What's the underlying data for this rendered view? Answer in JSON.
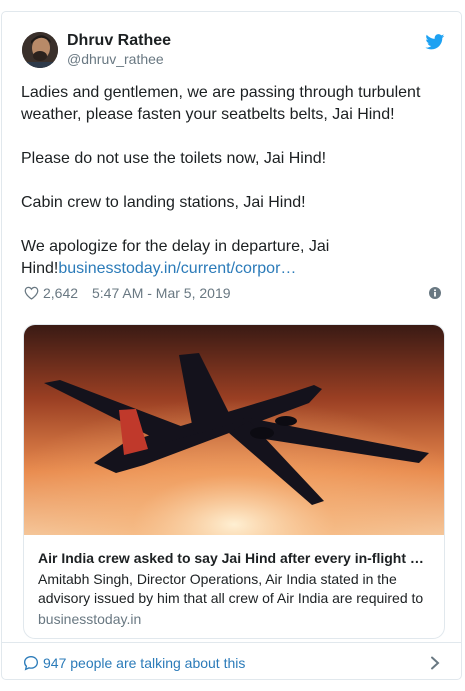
{
  "user": {
    "name": "Dhruv Rathee",
    "handle": "@dhruv_rathee"
  },
  "tweet": {
    "paragraphs": [
      "Ladies and gentlemen, we are passing through turbulent weather, please fasten your seatbelts belts, Jai Hind!",
      "Please do not use the toilets now, Jai Hind!",
      "Cabin crew to landing stations, Jai Hind!"
    ],
    "last_paragraph_text": "We apologize for the delay in departure, Jai Hind!",
    "link_text": "businesstoday.in/current/corpor…",
    "likes": "2,642",
    "timestamp": "5:47 AM - Mar 5, 2019"
  },
  "card": {
    "title": "Air India crew asked to say Jai Hind after every in-flight …",
    "description": "Amitabh Singh, Director Operations, Air India stated in the advisory issued by him that all crew of Air India are required to",
    "domain": "businesstoday.in"
  },
  "footer": {
    "talking_text": "947 people are talking about this"
  },
  "colors": {
    "link": "#2b7bb9",
    "muted": "#697882",
    "twitter_blue": "#1da1f2"
  },
  "icons": [
    "twitter-bird-icon",
    "heart-icon",
    "info-icon",
    "comment-icon",
    "chevron-right-icon"
  ]
}
